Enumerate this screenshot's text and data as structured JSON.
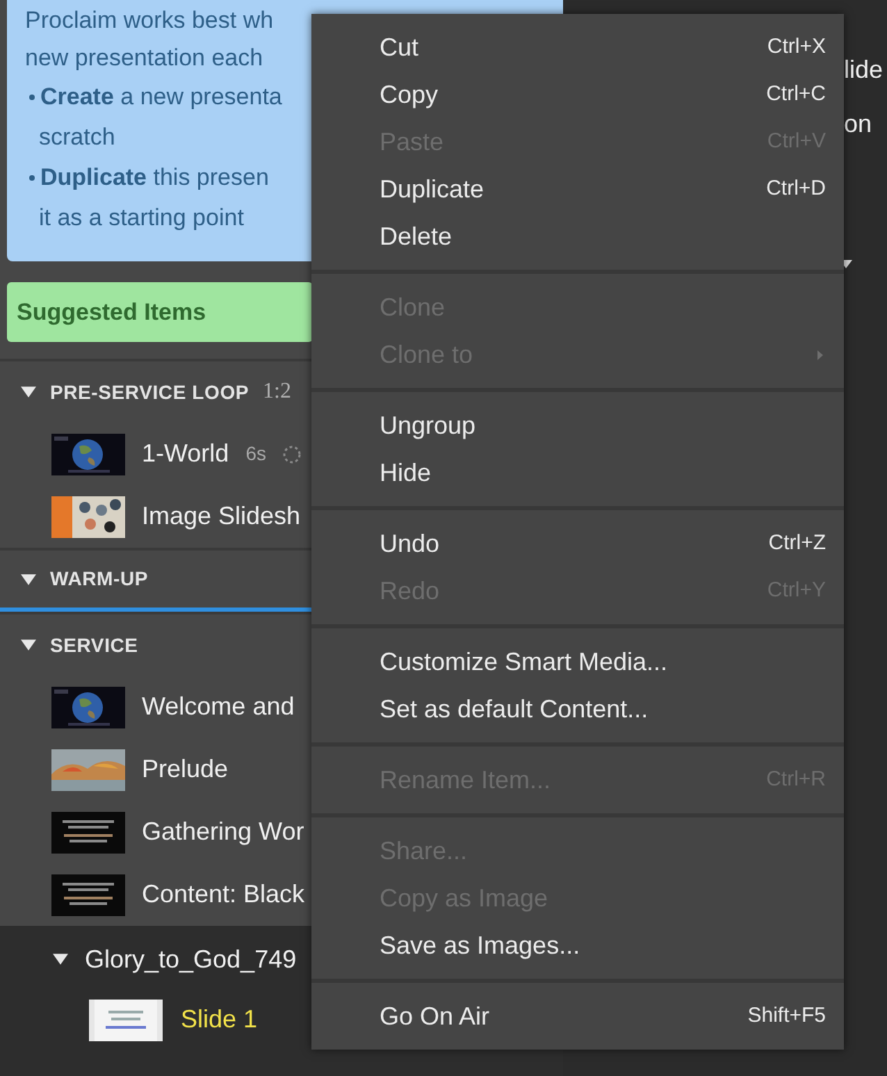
{
  "info_box": {
    "lines": [
      "Proclaim works best wh",
      "new presentation each"
    ],
    "bullets": [
      {
        "lines": [
          "**Create** a new presenta",
          "scratch"
        ]
      },
      {
        "lines": [
          "**Duplicate** this presen",
          "it as a starting point"
        ]
      }
    ]
  },
  "suggested_items": {
    "label": "Suggested Items"
  },
  "sections": [
    {
      "title": "PRE-SERVICE LOOP",
      "time": "1:2",
      "expanded": true,
      "selected": false,
      "items": [
        {
          "title": "1-World",
          "duration": "6s"
        },
        {
          "title": "Image Slidesh"
        }
      ]
    },
    {
      "title": "WARM-UP",
      "expanded": true,
      "selected": true
    },
    {
      "title": "SERVICE",
      "expanded": true,
      "selected": false,
      "items": [
        {
          "title": "Welcome and"
        },
        {
          "title": "Prelude"
        },
        {
          "title": "Gathering Wor"
        },
        {
          "title": "Content: Black"
        }
      ]
    }
  ],
  "group": {
    "title": "Glory_to_God_749",
    "expanded": true,
    "children": [
      {
        "title": "Slide 1",
        "selected": true
      }
    ]
  },
  "right_panel": {
    "lines": [
      "lide",
      "on"
    ]
  },
  "context_menu": {
    "groups": [
      {
        "items": [
          {
            "label": "Cut",
            "shortcut": "Ctrl+X",
            "disabled": false
          },
          {
            "label": "Copy",
            "shortcut": "Ctrl+C",
            "disabled": false
          },
          {
            "label": "Paste",
            "shortcut": "Ctrl+V",
            "disabled": true
          },
          {
            "label": "Duplicate",
            "shortcut": "Ctrl+D",
            "disabled": false
          },
          {
            "label": "Delete",
            "disabled": false
          }
        ]
      },
      {
        "items": [
          {
            "label": "Clone",
            "disabled": true
          },
          {
            "label": "Clone to",
            "disabled": true,
            "submenu": true
          }
        ]
      },
      {
        "items": [
          {
            "label": "Ungroup",
            "disabled": false
          },
          {
            "label": "Hide",
            "disabled": false
          }
        ]
      },
      {
        "items": [
          {
            "label": "Undo",
            "shortcut": "Ctrl+Z",
            "disabled": false
          },
          {
            "label": "Redo",
            "shortcut": "Ctrl+Y",
            "disabled": true
          }
        ]
      },
      {
        "items": [
          {
            "label": "Customize Smart Media...",
            "disabled": false
          },
          {
            "label": "Set as default Content...",
            "disabled": false
          }
        ]
      },
      {
        "items": [
          {
            "label": "Rename Item...",
            "shortcut": "Ctrl+R",
            "disabled": true
          }
        ]
      },
      {
        "items": [
          {
            "label": "Share...",
            "disabled": true
          },
          {
            "label": "Copy as Image",
            "disabled": true
          },
          {
            "label": "Save as Images...",
            "disabled": false
          }
        ]
      },
      {
        "items": [
          {
            "label": "Go On Air",
            "shortcut": "Shift+F5",
            "disabled": false
          }
        ]
      }
    ]
  }
}
